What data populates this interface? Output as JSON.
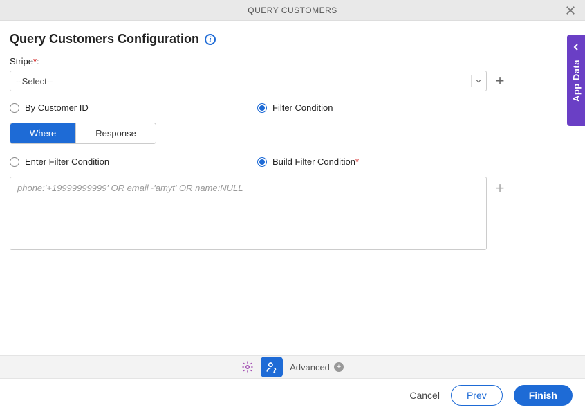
{
  "header": {
    "title": "QUERY CUSTOMERS"
  },
  "page": {
    "title": "Query Customers Configuration"
  },
  "stripe": {
    "label": "Stripe",
    "req": "*",
    "colon": ":",
    "selected": "--Select--"
  },
  "query_mode": {
    "options": [
      {
        "label": "By Customer ID",
        "checked": false
      },
      {
        "label": "Filter Condition",
        "checked": true
      }
    ]
  },
  "tabs": {
    "where": "Where",
    "response": "Response"
  },
  "filter_mode": {
    "options": [
      {
        "label": "Enter Filter Condition",
        "checked": false
      },
      {
        "label": "Build Filter Condition",
        "req": "*",
        "checked": true
      }
    ]
  },
  "filter_textarea": {
    "placeholder": "phone:'+19999999999' OR email~'amyt' OR name:NULL",
    "value": ""
  },
  "toolbar": {
    "advanced": "Advanced"
  },
  "footer": {
    "cancel": "Cancel",
    "prev": "Prev",
    "finish": "Finish"
  },
  "side_panel": {
    "label": "App Data"
  }
}
